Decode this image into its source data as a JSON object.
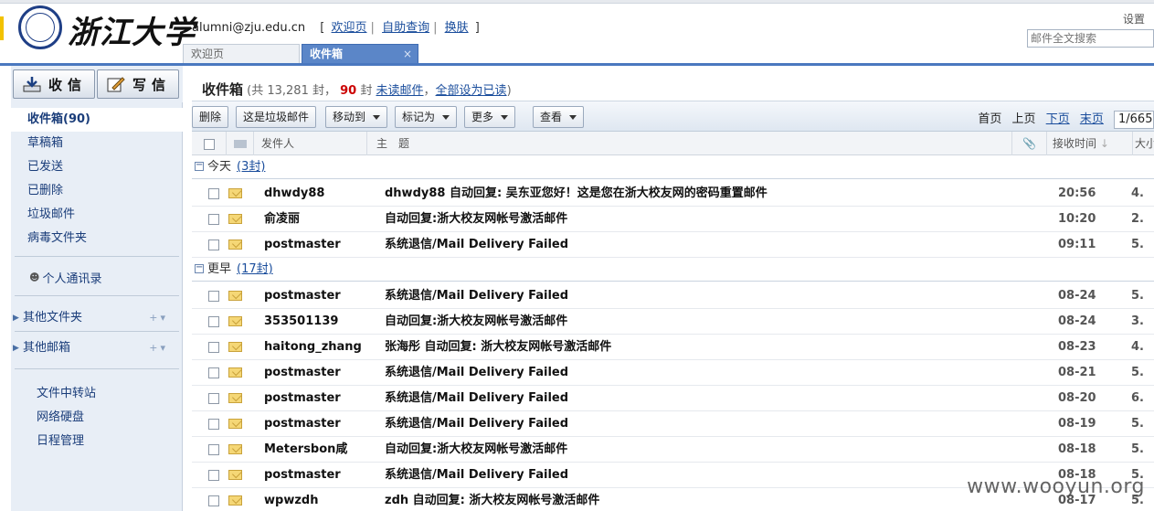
{
  "header": {
    "logo_text": "浙江大学",
    "email": "alumni@zju.edu.cn",
    "links": [
      "欢迎页",
      "自助查询",
      "换肤"
    ],
    "settings": "设置",
    "search_placeholder": "邮件全文搜索",
    "tabs": [
      {
        "label": "欢迎页",
        "active": false
      },
      {
        "label": "收件箱",
        "active": true,
        "close": "×"
      }
    ]
  },
  "sidebar": {
    "receive_label": "收信",
    "write_label": "写信",
    "folders": [
      "收件箱(90)",
      "草稿箱",
      "已发送",
      "已删除",
      "垃圾邮件",
      "病毒文件夹"
    ],
    "contacts": "个人通讯录",
    "other_folders": "其他文件夹",
    "other_mailboxes": "其他邮箱",
    "tools": [
      "文件中转站",
      "网络硬盘",
      "日程管理"
    ]
  },
  "main": {
    "title": "收件箱",
    "total_prefix": "(共 13,281 封，",
    "unread_count": "90",
    "unread_mid": "封",
    "unread_link": "未读邮件",
    "comma": "，",
    "mark_all_link": "全部设为已读",
    "close_paren": ")",
    "toolbar": {
      "delete": "删除",
      "spam": "这是垃圾邮件",
      "move": "移动到",
      "mark": "标记为",
      "more": "更多",
      "view": "查看"
    },
    "pager": {
      "first": "首页",
      "prev": "上页",
      "next": "下页",
      "last": "末页",
      "page": "1/665"
    },
    "columns": {
      "sender": "发件人",
      "subject": "主　题",
      "time": "接收时间",
      "size": "大小"
    },
    "groups": [
      {
        "label": "今天",
        "count": "(3封)",
        "rows": [
          {
            "from": "dhwdy88",
            "subject": "dhwdy88 自动回复: 吴东亚您好！这是您在浙大校友网的密码重置邮件",
            "time": "20:56",
            "size": "4."
          },
          {
            "from": "俞凌丽",
            "subject": "自动回复:浙大校友网帐号激活邮件",
            "time": "10:20",
            "size": "2."
          },
          {
            "from": "postmaster",
            "subject": "系统退信/Mail Delivery Failed",
            "time": "09:11",
            "size": "5."
          }
        ]
      },
      {
        "label": "更早",
        "count": "(17封)",
        "rows": [
          {
            "from": "postmaster",
            "subject": "系统退信/Mail Delivery Failed",
            "time": "08-24",
            "size": "5."
          },
          {
            "from": "353501139",
            "subject": "自动回复:浙大校友网帐号激活邮件",
            "time": "08-24",
            "size": "3."
          },
          {
            "from": "haitong_zhang",
            "subject": "张海彤 自动回复: 浙大校友网帐号激活邮件",
            "time": "08-23",
            "size": "4."
          },
          {
            "from": "postmaster",
            "subject": "系统退信/Mail Delivery Failed",
            "time": "08-21",
            "size": "5."
          },
          {
            "from": "postmaster",
            "subject": "系统退信/Mail Delivery Failed",
            "time": "08-20",
            "size": "6."
          },
          {
            "from": "postmaster",
            "subject": "系统退信/Mail Delivery Failed",
            "time": "08-19",
            "size": "5."
          },
          {
            "from": "Metersbon咸",
            "subject": "自动回复:浙大校友网帐号激活邮件",
            "time": "08-18",
            "size": "5."
          },
          {
            "from": "postmaster",
            "subject": "系统退信/Mail Delivery Failed",
            "time": "08-18",
            "size": "5."
          },
          {
            "from": "wpwzdh",
            "subject": "zdh 自动回复: 浙大校友网帐号激活邮件",
            "time": "08-17",
            "size": "5."
          }
        ]
      }
    ]
  },
  "watermark": "www.wooyun.org"
}
